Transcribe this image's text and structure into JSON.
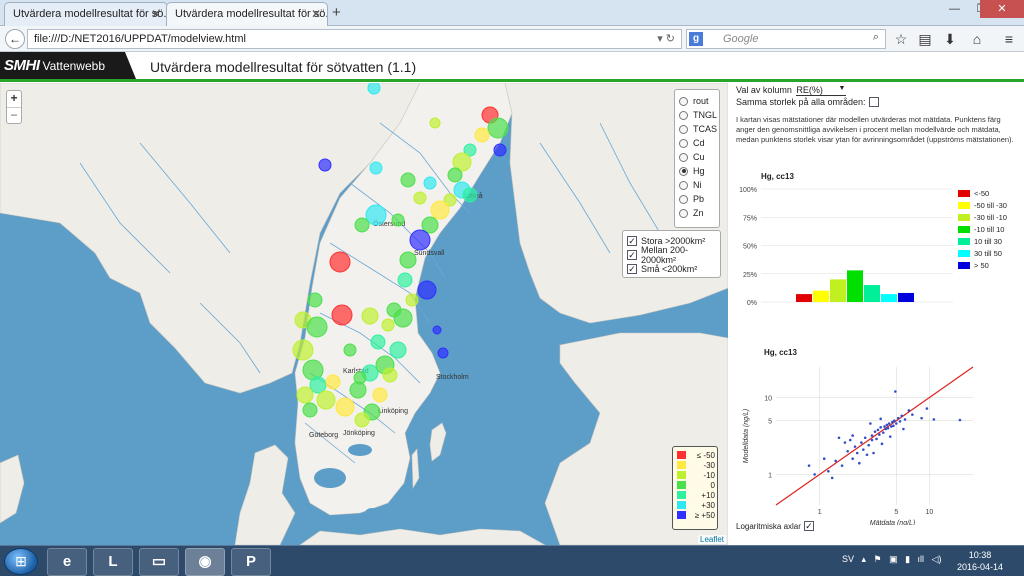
{
  "browser": {
    "tabs": [
      {
        "label": "Utvärdera modellresultat för sö..."
      },
      {
        "label": "Utvärdera modellresultat för sö..."
      }
    ],
    "new_tab": "+",
    "url": "file:///D:/NET2016/UPPDAT/modelview.html",
    "search_engine": "Google",
    "search_placeholder": "Google"
  },
  "app": {
    "brand": "SMHI",
    "product": "Vattenwebb",
    "title": "Utvärdera modellresultat för sötvatten (1.1)"
  },
  "map": {
    "zoom_in": "+",
    "zoom_out": "−",
    "metals": [
      {
        "label": "rout",
        "selected": false
      },
      {
        "label": "TNGL",
        "selected": false
      },
      {
        "label": "TCAS",
        "selected": false
      },
      {
        "label": "Cd",
        "selected": false
      },
      {
        "label": "Cu",
        "selected": false
      },
      {
        "label": "Hg",
        "selected": true
      },
      {
        "label": "Ni",
        "selected": false
      },
      {
        "label": "Pb",
        "selected": false
      },
      {
        "label": "Zn",
        "selected": false
      }
    ],
    "size_filters": [
      {
        "label": "Stora >2000km²",
        "checked": true
      },
      {
        "label": "Mellan 200-2000km²",
        "checked": true
      },
      {
        "label": "Små <200km²",
        "checked": true
      }
    ],
    "legend": [
      {
        "label": "≤ -50",
        "color": "#ff3030"
      },
      {
        "label": "-30",
        "color": "#ffe840"
      },
      {
        "label": "-10",
        "color": "#bff030"
      },
      {
        "label": "0",
        "color": "#4be04b"
      },
      {
        "label": "+10",
        "color": "#30f0a0"
      },
      {
        "label": "+30",
        "color": "#30e8f0"
      },
      {
        "label": "≥ +50",
        "color": "#3030ff"
      }
    ],
    "city_labels": [
      "Östersund",
      "Sundsvall",
      "Karlstad",
      "Stockholm",
      "Linköping",
      "Göteborg",
      "Jönköping",
      "Umeå"
    ],
    "attribution": "Leaflet"
  },
  "panel": {
    "column_label": "Val av kolumn",
    "column_value": "RE(%)",
    "same_size_label": "Samma storlek på alla områden:",
    "same_size_checked": false,
    "description": "I kartan visas mätstationer där modellen utvärderas mot mätdata. Punktens färg anger den genomsnittliga avvikelsen i procent mellan modellvärde och mätdata, medan punktens storlek visar ytan för avrinningsområdet (uppströms mätstationen).",
    "histogram_title": "Hg, cc13",
    "scatter_title": "Hg, cc13",
    "log_axes_label": "Logaritmiska axlar",
    "log_axes_checked": true
  },
  "chart_data": [
    {
      "type": "bar",
      "title": "Hg, cc13",
      "categories": [
        "<-50",
        "-50 till -30",
        "-30 till -10",
        "-10 till 10",
        "10 till 30",
        "30 till 50",
        "> 50"
      ],
      "values": [
        7,
        10,
        20,
        28,
        15,
        7,
        8
      ],
      "colors": [
        "#e00000",
        "#ffff00",
        "#c0f020",
        "#00e000",
        "#00f09a",
        "#00ffff",
        "#0000dd"
      ],
      "yticks": [
        "0%",
        "25%",
        "50%",
        "75%",
        "100%"
      ],
      "ylim": [
        0,
        100
      ]
    },
    {
      "type": "scatter",
      "title": "Hg, cc13",
      "xlabel": "Mätdata (ng/L)",
      "ylabel": "Modelldata (ng/L)",
      "xticks": [
        "1",
        "5",
        "10"
      ],
      "yticks": [
        "1",
        "5",
        "10"
      ],
      "log_scale": true,
      "xlim": [
        0.4,
        25
      ],
      "ylim": [
        0.4,
        25
      ],
      "line": [
        [
          0.4,
          0.4
        ],
        [
          25,
          25
        ]
      ],
      "points": [
        [
          0.9,
          1.0
        ],
        [
          1.2,
          1.1
        ],
        [
          1.4,
          1.5
        ],
        [
          1.6,
          1.3
        ],
        [
          1.8,
          2.0
        ],
        [
          2.0,
          1.6
        ],
        [
          2.1,
          2.3
        ],
        [
          2.2,
          1.9
        ],
        [
          2.4,
          2.6
        ],
        [
          2.5,
          2.1
        ],
        [
          2.6,
          3.0
        ],
        [
          2.8,
          2.4
        ],
        [
          3.0,
          3.2
        ],
        [
          3.0,
          2.8
        ],
        [
          3.2,
          3.6
        ],
        [
          3.3,
          2.9
        ],
        [
          3.4,
          3.8
        ],
        [
          3.5,
          3.3
        ],
        [
          3.6,
          4.1
        ],
        [
          3.8,
          3.5
        ],
        [
          3.9,
          4.2
        ],
        [
          4.0,
          3.9
        ],
        [
          4.1,
          4.4
        ],
        [
          4.2,
          4.0
        ],
        [
          4.3,
          4.6
        ],
        [
          4.5,
          4.2
        ],
        [
          4.6,
          4.8
        ],
        [
          4.7,
          4.3
        ],
        [
          4.8,
          5.0
        ],
        [
          5.0,
          4.6
        ],
        [
          5.2,
          5.4
        ],
        [
          5.4,
          4.9
        ],
        [
          5.6,
          5.8
        ],
        [
          6.0,
          5.2
        ],
        [
          6.5,
          6.8
        ],
        [
          7.0,
          6.0
        ],
        [
          1.5,
          3.0
        ],
        [
          1.7,
          2.6
        ],
        [
          2.0,
          3.2
        ],
        [
          2.3,
          1.4
        ],
        [
          2.7,
          1.8
        ],
        [
          3.1,
          1.9
        ],
        [
          1.3,
          0.9
        ],
        [
          1.1,
          1.6
        ],
        [
          0.8,
          1.3
        ],
        [
          3.7,
          2.5
        ],
        [
          4.4,
          3.1
        ],
        [
          5.8,
          3.9
        ],
        [
          8.5,
          5.4
        ],
        [
          11,
          5.2
        ],
        [
          4.9,
          12
        ],
        [
          19,
          5.1
        ],
        [
          9.5,
          7.2
        ],
        [
          2.9,
          4.6
        ],
        [
          3.6,
          5.3
        ],
        [
          1.9,
          2.8
        ]
      ]
    }
  ]
}
